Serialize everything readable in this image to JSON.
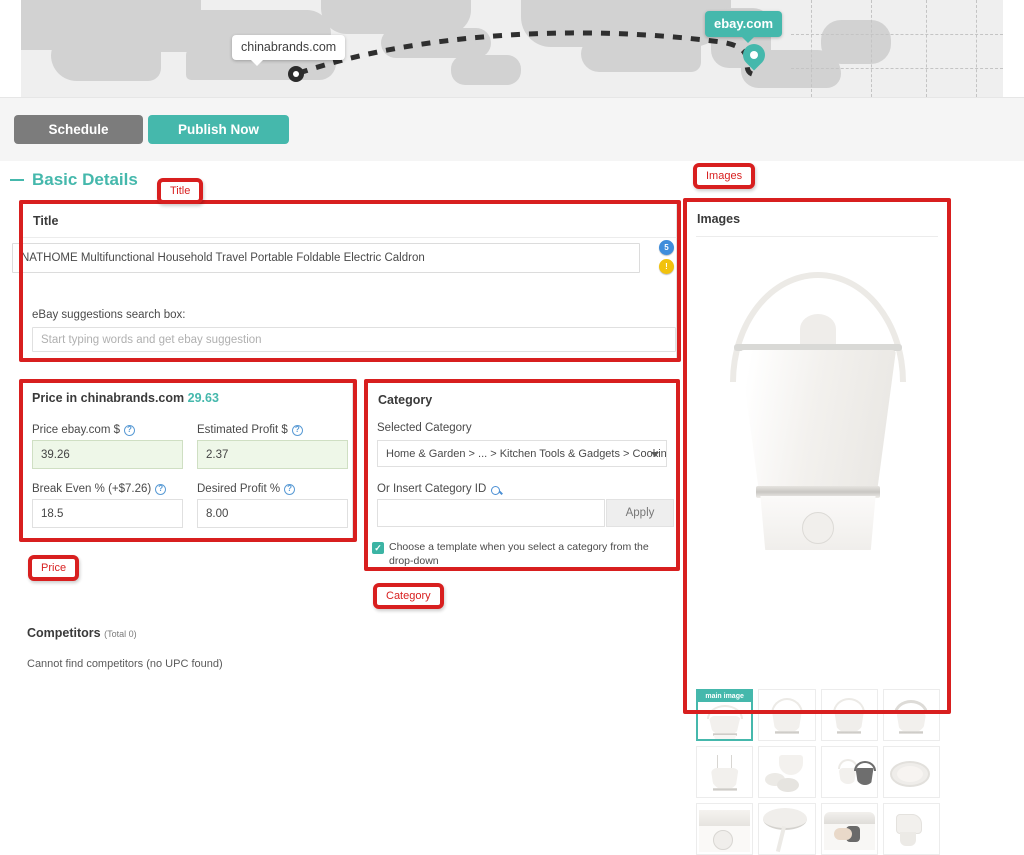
{
  "map": {
    "source_label": "chinabrands.com",
    "destination_label": "ebay.com"
  },
  "actions": {
    "schedule_label": "Schedule",
    "publish_label": "Publish Now"
  },
  "section": {
    "basic_details_label": "Basic Details"
  },
  "title_panel": {
    "heading": "Title",
    "title_value": "NATHOME Multifunctional Household Travel Portable Foldable Electric Caldron",
    "char_badge": "5",
    "suggestions_label": "eBay suggestions search box:",
    "suggestions_placeholder": "Start typing words and get ebay suggestion",
    "suggestions_value": ""
  },
  "price_panel": {
    "heading": "Price in chinabrands.com",
    "source_price": "29.63",
    "fields": [
      {
        "label": "Price ebay.com $",
        "value": "39.26",
        "highlighted": true
      },
      {
        "label": "Estimated Profit $",
        "value": "2.37",
        "highlighted": true
      },
      {
        "label": "Break Even % (+$7.26)",
        "value": "18.5",
        "highlighted": false
      },
      {
        "label": "Desired Profit %",
        "value": "8.00",
        "highlighted": false
      }
    ]
  },
  "category_panel": {
    "heading": "Category",
    "selected_label": "Selected Category",
    "selected_value": "Home & Garden > ... > Kitchen Tools & Gadgets > Cooking Utensil",
    "insert_id_label": "Or Insert Category ID",
    "category_id_value": "",
    "apply_label": "Apply",
    "template_checkbox_label": "Choose a template when you select a category from the drop-down",
    "template_checked": true
  },
  "competitors": {
    "heading": "Competitors",
    "total_label": "(Total 0)",
    "message": "Cannot find competitors (no UPC found)"
  },
  "images_panel": {
    "heading": "Images",
    "main_badge": "main image",
    "thumbnail_count": 12,
    "selected_index": 0
  },
  "annotations": [
    {
      "label": "Title"
    },
    {
      "label": "Images"
    },
    {
      "label": "Price"
    },
    {
      "label": "Category"
    }
  ],
  "colors": {
    "accent_teal": "#45b8ac",
    "schedule_gray": "#7c7c7c",
    "annotation_red": "#d81f1f",
    "highlight_green_bg": "#eef7e8"
  }
}
